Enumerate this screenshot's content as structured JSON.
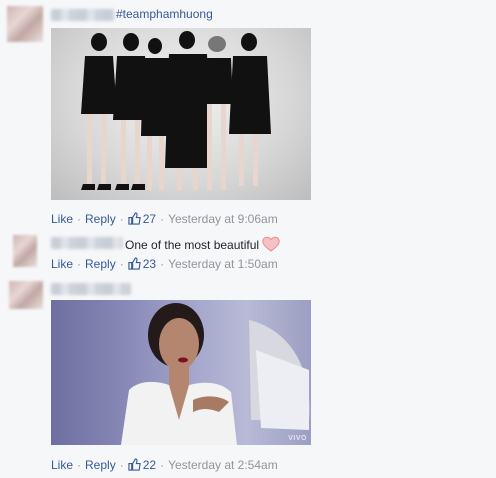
{
  "posts": [
    {
      "hashtag": "#teamphamhuong",
      "actions": {
        "like": "Like",
        "reply": "Reply",
        "likes": "27",
        "time": "Yesterday at 9:06am"
      }
    },
    {
      "text": "One of the most beautiful",
      "actions": {
        "like": "Like",
        "reply": "Reply",
        "likes": "23",
        "time": "Yesterday at 1:50am"
      }
    },
    {
      "watermark": "VIVO",
      "actions": {
        "like": "Like",
        "reply": "Reply",
        "likes": "22",
        "time": "Yesterday at 2:54am"
      }
    }
  ],
  "colors": {
    "link": "#365899",
    "meta": "#90949c",
    "heart": "#f3a5a8"
  },
  "icons": [
    "thumbs-up-icon",
    "heart-icon"
  ]
}
